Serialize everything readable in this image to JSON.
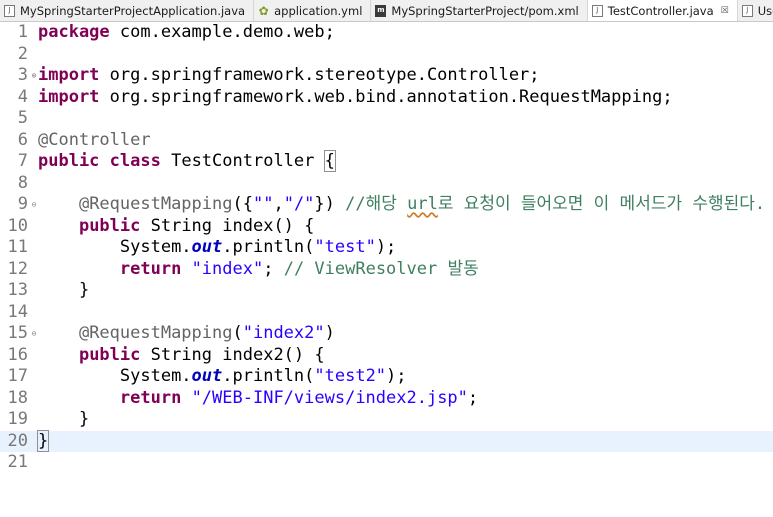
{
  "tabs": [
    {
      "label": "MySpringStarterProjectApplication.java",
      "icon": "java-file-icon",
      "active": false
    },
    {
      "label": "application.yml",
      "icon": "yml-file-icon",
      "active": false
    },
    {
      "label": "MySpringStarterProject/pom.xml",
      "icon": "maven-pom-icon",
      "active": false
    },
    {
      "label": "TestController.java",
      "icon": "java-file-icon",
      "active": true,
      "close": "☒"
    },
    {
      "label": "UserC",
      "icon": "java-file-icon",
      "active": false
    }
  ],
  "editor": {
    "lines": [
      {
        "n": "1"
      },
      {
        "n": "2"
      },
      {
        "n": "3"
      },
      {
        "n": "4"
      },
      {
        "n": "5"
      },
      {
        "n": "6"
      },
      {
        "n": "7"
      },
      {
        "n": "8"
      },
      {
        "n": "9"
      },
      {
        "n": "10"
      },
      {
        "n": "11"
      },
      {
        "n": "12"
      },
      {
        "n": "13"
      },
      {
        "n": "14"
      },
      {
        "n": "15"
      },
      {
        "n": "16"
      },
      {
        "n": "17"
      },
      {
        "n": "18"
      },
      {
        "n": "19"
      },
      {
        "n": "20"
      },
      {
        "n": "21"
      }
    ],
    "t": {
      "package": "package",
      "pkg_name": " com.example.demo.web;",
      "import": "import",
      "imp1": " org.springframework.stereotype.Controller;",
      "imp2": " org.springframework.web.bind.annotation.RequestMapping;",
      "ann_controller": "@Controller",
      "public": "public",
      "class": "class",
      "class_name": " TestController ",
      "brace_open": "{",
      "ann_rm": "@RequestMapping",
      "rm1_open": "({",
      "rm1_s1": "\"\"",
      "comma": ",",
      "rm1_s2": "\"/\"",
      "rm1_close": "}) ",
      "rm1_comment_a": "//해당 ",
      "rm1_comment_url": "url",
      "rm1_comment_b": "로 요청이 들어오면 이 메서드가 수행된다.",
      "string_type": " String ",
      "index_sig": "index() {",
      "system": "System.",
      "out": "out",
      "println_open": ".println(",
      "s_test": "\"test\"",
      "close_paren": ");",
      "return": "return",
      "s_index": "\"index\"",
      "semi_space": "; ",
      "comment_vr": "// ViewResolver 발동",
      "brace_close": "}",
      "rm2_open": "(",
      "s_index2": "\"index2\"",
      "rm2_close": ")",
      "index2_sig": "index2() {",
      "s_test2": "\"test2\"",
      "s_jsp": "\"/WEB-INF/views/index2.jsp\"",
      "semi": ";"
    },
    "colors": {
      "keyword": "#7f0055",
      "string": "#2a00ff",
      "annotation": "#646464",
      "comment": "#3f7f5f",
      "static_field": "#0000c0",
      "current_line": "#e8f2fe"
    }
  }
}
